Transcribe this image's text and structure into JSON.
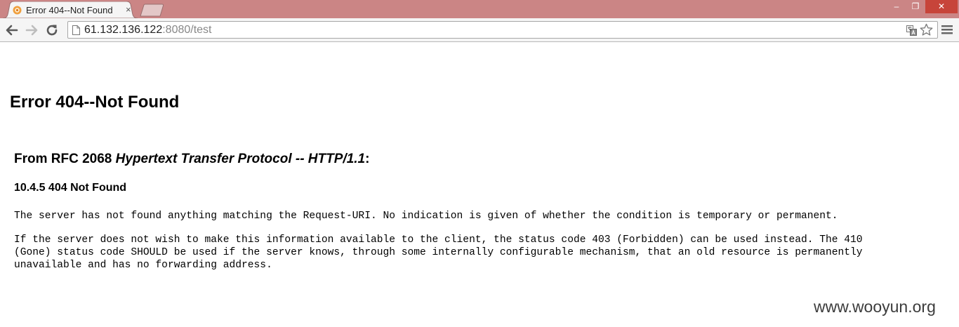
{
  "tab": {
    "title": "Error 404--Not Found",
    "close_glyph": "×"
  },
  "window_controls": {
    "minimize": "‒",
    "restore": "❐",
    "close": "✕"
  },
  "address_bar": {
    "host": "61.132.136.122",
    "rest": ":8080/test"
  },
  "page": {
    "title": "Error 404--Not Found",
    "rfc_prefix": "From RFC 2068 ",
    "rfc_title": "Hypertext Transfer Protocol -- HTTP/1.1",
    "rfc_suffix": ":",
    "section": "10.4.5 404 Not Found",
    "paragraph1": "The server has not found anything matching the Request-URI. No indication is given of whether the condition is temporary or permanent.",
    "paragraph2": "If the server does not wish to make this information available to the client, the status code 403 (Forbidden) can be used instead. The 410\n(Gone) status code SHOULD be used if the server knows, through some internally configurable mechanism, that an old resource is permanently\nunavailable and has no forwarding address."
  },
  "watermark": "www.wooyun.org",
  "colors": {
    "titlebar": "#cb8585",
    "close_button": "#c7443a",
    "toolbar": "#f5f5f5"
  },
  "icons": [
    "favicon-icon",
    "tab-close-icon",
    "new-tab-icon",
    "minimize-icon",
    "restore-icon",
    "window-close-icon",
    "back-arrow-icon",
    "forward-arrow-icon",
    "reload-icon",
    "page-icon",
    "translate-icon",
    "star-icon",
    "menu-icon"
  ]
}
